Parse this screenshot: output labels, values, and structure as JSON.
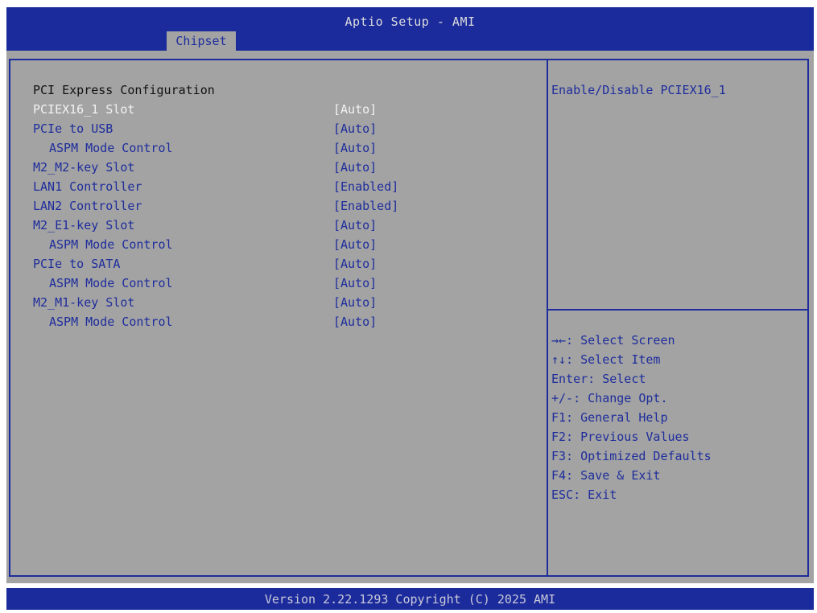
{
  "header": {
    "title": "Aptio Setup - AMI",
    "tabs": [
      {
        "label": "Chipset"
      }
    ]
  },
  "main": {
    "section_title": "PCI Express Configuration",
    "settings": [
      {
        "label": "PCIEX16_1 Slot",
        "value": "[Auto]",
        "selected": true,
        "indent": false
      },
      {
        "label": "PCIe to USB",
        "value": "[Auto]",
        "selected": false,
        "indent": false
      },
      {
        "label": "ASPM Mode Control",
        "value": "[Auto]",
        "selected": false,
        "indent": true
      },
      {
        "label": "M2_M2-key Slot",
        "value": "[Auto]",
        "selected": false,
        "indent": false
      },
      {
        "label": "LAN1 Controller",
        "value": "[Enabled]",
        "selected": false,
        "indent": false
      },
      {
        "label": "LAN2 Controller",
        "value": "[Enabled]",
        "selected": false,
        "indent": false
      },
      {
        "label": "M2_E1-key Slot",
        "value": "[Auto]",
        "selected": false,
        "indent": false
      },
      {
        "label": "ASPM Mode Control",
        "value": "[Auto]",
        "selected": false,
        "indent": true
      },
      {
        "label": "PCIe to SATA",
        "value": "[Auto]",
        "selected": false,
        "indent": false
      },
      {
        "label": "ASPM Mode Control",
        "value": "[Auto]",
        "selected": false,
        "indent": true
      },
      {
        "label": "M2_M1-key Slot",
        "value": "[Auto]",
        "selected": false,
        "indent": false
      },
      {
        "label": "ASPM Mode Control",
        "value": "[Auto]",
        "selected": false,
        "indent": true
      }
    ]
  },
  "help": {
    "text": "Enable/Disable PCIEX16_1",
    "keys": [
      "→←: Select Screen",
      "↑↓: Select Item",
      "Enter: Select",
      "+/-: Change Opt.",
      "F1: General Help",
      "F2: Previous Values",
      "F3: Optimized Defaults",
      "F4: Save & Exit",
      "ESC: Exit"
    ]
  },
  "footer": {
    "version": "Version 2.22.1293 Copyright (C) 2025 AMI"
  },
  "colors": {
    "header_bg": "#1b2b9c",
    "panel_bg": "#a3a3a3",
    "accent_text": "#1e2d9c",
    "selected_text": "#f2f2f2"
  }
}
